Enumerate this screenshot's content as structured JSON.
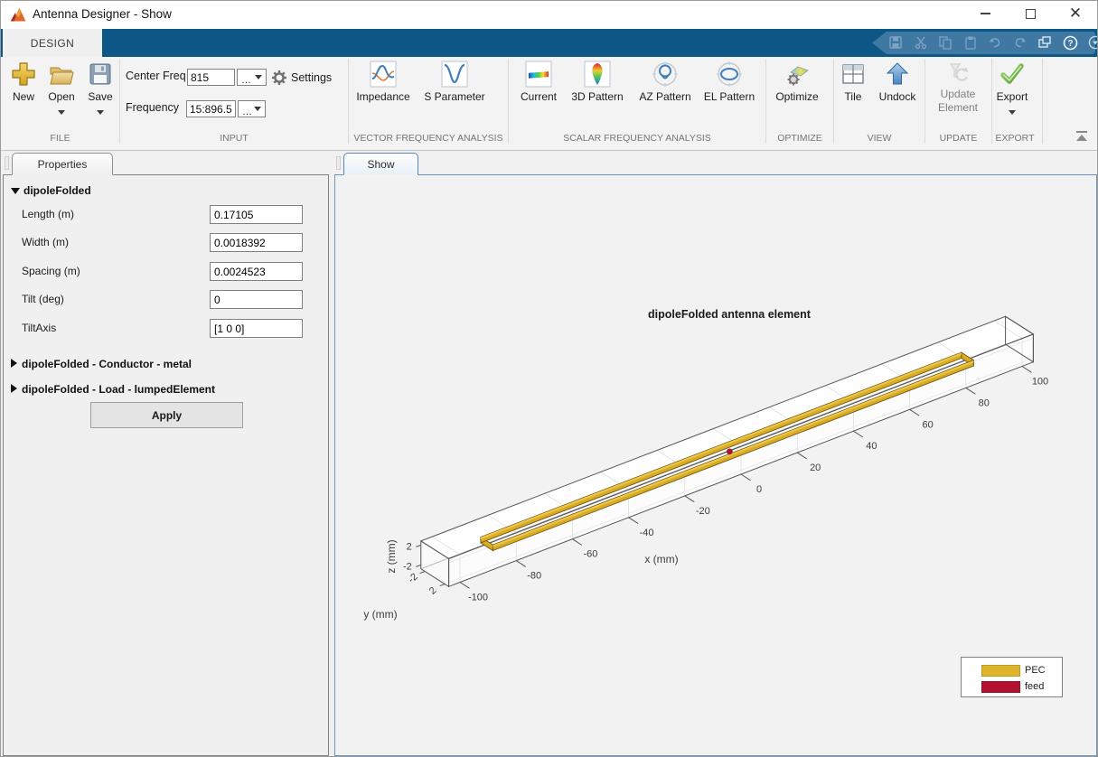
{
  "window": {
    "title": "Antenna Designer - Show"
  },
  "ribbon": {
    "tab": "DESIGN",
    "file": {
      "new": "New",
      "open": "Open",
      "save": "Save",
      "section": "FILE"
    },
    "input": {
      "center_freq_label": "Center Freq",
      "center_freq_value": "815",
      "frequency_label": "Frequency",
      "frequency_value": "15:896.5",
      "ellipsis": "...",
      "settings": "Settings",
      "section": "INPUT"
    },
    "vector": {
      "impedance": "Impedance",
      "s_parameter": "S Parameter",
      "section": "VECTOR FREQUENCY ANALYSIS"
    },
    "scalar": {
      "current": "Current",
      "pattern3d": "3D Pattern",
      "az": "AZ Pattern",
      "el": "EL Pattern",
      "section": "SCALAR FREQUENCY ANALYSIS"
    },
    "optimize": {
      "optimize": "Optimize",
      "section": "OPTIMIZE"
    },
    "view": {
      "tile": "Tile",
      "undock": "Undock",
      "section": "VIEW"
    },
    "update": {
      "line1": "Update",
      "line2": "Element",
      "section": "UPDATE"
    },
    "export": {
      "export": "Export",
      "section": "EXPORT"
    }
  },
  "properties_panel": {
    "tab": "Properties",
    "group": "dipoleFolded",
    "fields": [
      {
        "label": "Length (m)",
        "value": "0.17105"
      },
      {
        "label": "Width (m)",
        "value": "0.0018392"
      },
      {
        "label": "Spacing (m)",
        "value": "0.0024523"
      },
      {
        "label": "Tilt (deg)",
        "value": "0"
      },
      {
        "label": "TiltAxis",
        "value": "[1 0 0]"
      }
    ],
    "conductor_section": "dipoleFolded - Conductor - metal",
    "load_section": "dipoleFolded - Load - lumpedElement",
    "apply": "Apply"
  },
  "show_panel": {
    "tab": "Show"
  },
  "chart_data": {
    "type": "3d-model",
    "title": "dipoleFolded antenna element",
    "xlabel": "x (mm)",
    "ylabel": "y (mm)",
    "zlabel": "z (mm)",
    "x_ticks": [
      -100,
      -80,
      -60,
      -40,
      -20,
      0,
      20,
      40,
      60,
      80,
      100
    ],
    "y_ticks": [
      -2,
      2
    ],
    "z_ticks": [
      2,
      -2
    ],
    "x_range": [
      -104,
      104
    ],
    "y_range": [
      -2.8,
      2.8
    ],
    "z_range": [
      -2.8,
      2.8
    ],
    "legend": [
      {
        "label": "PEC",
        "color": "#deb42c"
      },
      {
        "label": "feed",
        "color": "#b3122e"
      }
    ],
    "element": {
      "name": "dipoleFolded",
      "length_mm": 171.05,
      "width_mm": 1.8392,
      "spacing_mm": 2.4523,
      "feed_at": [
        0,
        0,
        0
      ]
    }
  }
}
